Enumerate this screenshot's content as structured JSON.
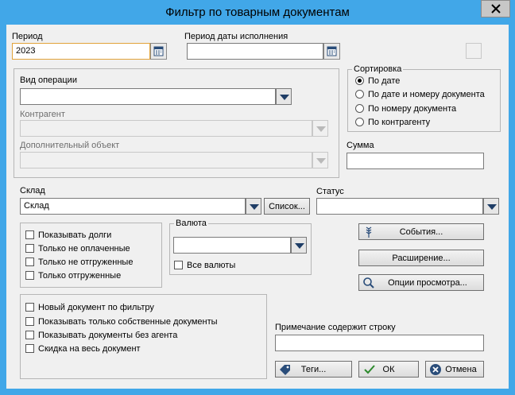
{
  "window": {
    "title": "Фильтр по товарным документам"
  },
  "period": {
    "label": "Период",
    "value": "2023"
  },
  "exec_period": {
    "label": "Период даты исполнения",
    "value": ""
  },
  "operation": {
    "label": "Вид операции",
    "value": ""
  },
  "counterparty": {
    "label": "Контрагент",
    "value": ""
  },
  "extra_object": {
    "label": "Дополнительный объект",
    "value": ""
  },
  "sorting": {
    "title": "Сортировка",
    "options": [
      "По дате",
      "По дате и номеру документа",
      "По номеру документа",
      "По контрагенту"
    ],
    "selected": "По дате"
  },
  "sum": {
    "label": "Сумма",
    "value": ""
  },
  "warehouse": {
    "label": "Склад",
    "value": "Склад",
    "list_button": "Список..."
  },
  "status": {
    "label": "Статус",
    "value": ""
  },
  "debts_group": {
    "items": [
      "Показывать долги",
      "Только не оплаченные",
      "Только не отгруженные",
      "Только отгруженные"
    ]
  },
  "currency": {
    "title": "Валюта",
    "value": "",
    "all_label": "Все валюты"
  },
  "buttons": {
    "events": "События...",
    "extension": "Расширение...",
    "view_options": "Опции просмотра...",
    "tags": "Теги...",
    "ok": "ОК",
    "cancel": "Отмена"
  },
  "doc_group": {
    "items": [
      "Новый документ по фильтру",
      "Показывать только собственные документы",
      "Показывать документы без агента",
      "Скидка на весь документ"
    ]
  },
  "note": {
    "label": "Примечание содержит строку",
    "value": ""
  }
}
